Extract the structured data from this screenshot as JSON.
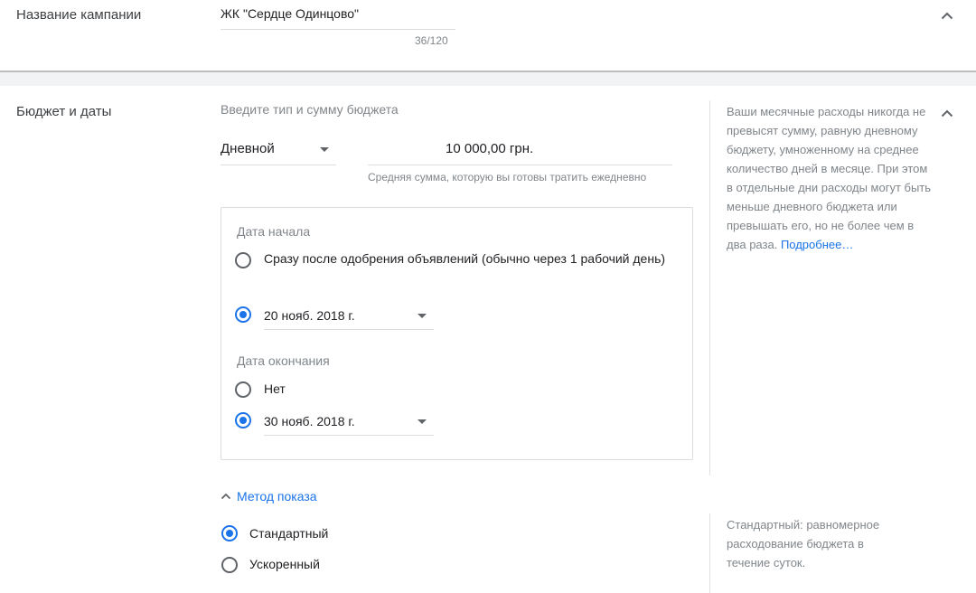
{
  "campaign": {
    "label": "Название кампании",
    "name_value": "ЖК \"Сердце Одинцово\"",
    "char_counter": "36/120"
  },
  "budget": {
    "label": "Бюджет и даты",
    "hint": "Введите тип и сумму бюджета",
    "type_value": "Дневной",
    "amount_value": "10 000,00 грн.",
    "amount_helper": "Средняя сумма, которую вы готовы тратить ежедневно",
    "help_text": "Ваши месячные расходы никогда не превысят сумму, равную дневному бюджету, умноженному на среднее количество дней в месяце. При этом в отдельные дни расходы могут быть меньше дневного бюджета или превышать его, но не более чем в два раза.",
    "help_link": "Подробнее…"
  },
  "dates": {
    "start_title": "Дата начала",
    "start_option_asap": "Сразу после одобрения объявлений (обычно через 1 рабочий день)",
    "start_date_value": "20 нояб. 2018 г.",
    "start_selected": "date",
    "end_title": "Дата окончания",
    "end_option_none": "Нет",
    "end_date_value": "30 нояб. 2018 г.",
    "end_selected": "date"
  },
  "delivery": {
    "label": "Метод показа",
    "option_standard": "Стандартный",
    "option_accelerated": "Ускоренный",
    "selected": "standard",
    "help_text": "Стандартный: равномерное расходование бюджета в течение суток."
  },
  "colors": {
    "accent": "#1a73e8",
    "secondary_text": "#80868b",
    "section_gap": "#f1f3f4"
  },
  "icons": {
    "collapse": "chevron-up-icon",
    "dropdown": "arrow-drop-down-icon"
  }
}
